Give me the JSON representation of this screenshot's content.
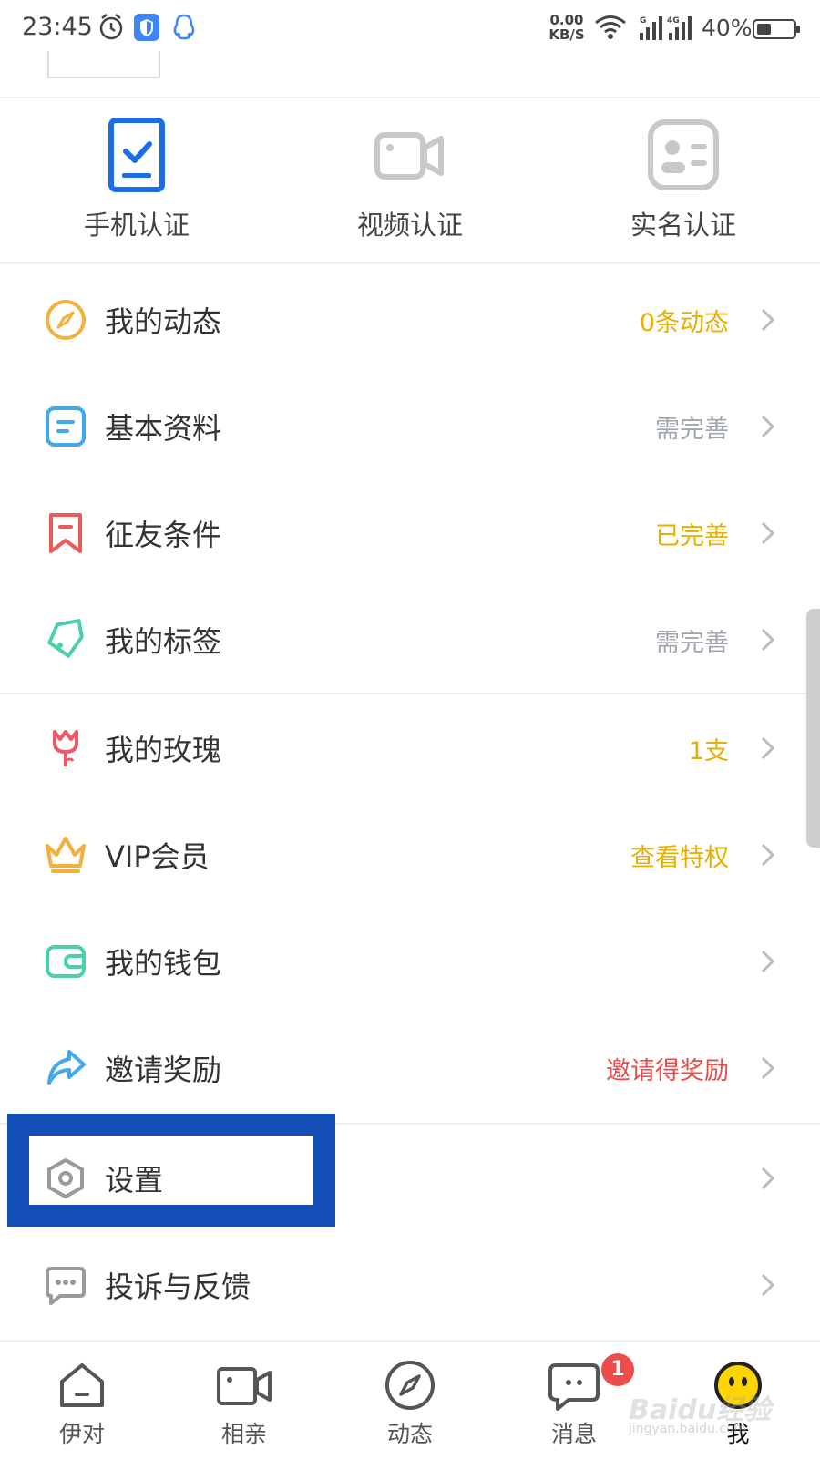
{
  "status_bar": {
    "time": "23:45",
    "net_speed_value": "0.00",
    "net_speed_unit": "KB/S",
    "battery_percent": "40%",
    "battery_level": 0.4,
    "icons": [
      "alarm-icon",
      "shield-icon",
      "qq-icon",
      "wifi-icon",
      "signal-icon",
      "signal-4g-icon",
      "battery-icon"
    ]
  },
  "verification": [
    {
      "label": "手机认证",
      "icon": "phone-verify-icon",
      "color": "#1a6ee8",
      "active": true
    },
    {
      "label": "视频认证",
      "icon": "video-verify-icon",
      "color": "#c8c8c8",
      "active": false
    },
    {
      "label": "实名认证",
      "icon": "id-verify-icon",
      "color": "#c8c8c8",
      "active": false
    }
  ],
  "menu": [
    {
      "label": "我的动态",
      "value": "0条动态",
      "value_color": "#e6b000",
      "icon": "compass-icon",
      "icon_color": "#f4b03c"
    },
    {
      "label": "基本资料",
      "value": "需完善",
      "value_color": "#a0a6ad",
      "icon": "profile-card-icon",
      "icon_color": "#42a8ec"
    },
    {
      "label": "征友条件",
      "value": "已完善",
      "value_color": "#e6b000",
      "icon": "bookmark-icon",
      "icon_color": "#ec5a5a"
    },
    {
      "label": "我的标签",
      "value": "需完善",
      "value_color": "#a0a6ad",
      "icon": "tag-icon",
      "icon_color": "#4ccfae"
    },
    {
      "label": "我的玫瑰",
      "value": "1支",
      "value_color": "#e6b000",
      "icon": "rose-icon",
      "icon_color": "#ec5a6a"
    },
    {
      "label": "VIP会员",
      "value": "查看特权",
      "value_color": "#e6b000",
      "icon": "crown-icon",
      "icon_color": "#f4b03c"
    },
    {
      "label": "我的钱包",
      "value": "",
      "value_color": "#a0a6ad",
      "icon": "wallet-icon",
      "icon_color": "#4ccfae"
    },
    {
      "label": "邀请奖励",
      "value": "邀请得奖励",
      "value_color": "#ea4b4b",
      "icon": "share-icon",
      "icon_color": "#42a8ec"
    },
    {
      "label": "设置",
      "value": "",
      "value_color": "#a0a6ad",
      "icon": "settings-hex-icon",
      "icon_color": "#9a9a9a"
    },
    {
      "label": "投诉与反馈",
      "value": "",
      "value_color": "#a0a6ad",
      "icon": "feedback-chat-icon",
      "icon_color": "#9a9a9a"
    }
  ],
  "bottom_nav": [
    {
      "label": "伊对",
      "icon": "home-icon",
      "active": false
    },
    {
      "label": "相亲",
      "icon": "video-camera-icon",
      "active": false
    },
    {
      "label": "动态",
      "icon": "compass-nav-icon",
      "active": false
    },
    {
      "label": "消息",
      "icon": "message-icon",
      "active": false,
      "badge": "1"
    },
    {
      "label": "我",
      "icon": "me-face-icon",
      "active": true
    }
  ],
  "highlight_color": "#134fb7",
  "watermark": {
    "main": "Baidu经验",
    "sub": "jingyan.baidu.com"
  }
}
